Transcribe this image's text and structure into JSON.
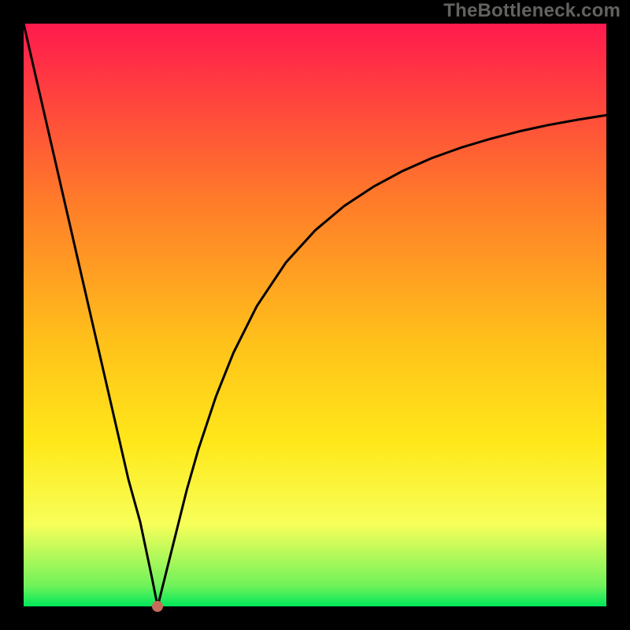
{
  "watermark": "TheBottleneck.com",
  "chart_data": {
    "type": "line",
    "title": "",
    "xlabel": "",
    "ylabel": "",
    "xlim": [
      0,
      100
    ],
    "ylim": [
      0,
      100
    ],
    "background_gradient": [
      "#ff1a4d",
      "#ff7a2a",
      "#ffc21a",
      "#ffe81a",
      "#f7ff5a",
      "#6ff25a",
      "#00e85a"
    ],
    "series": [
      {
        "name": "curve",
        "x": [
          0,
          2,
          4,
          6,
          8,
          10,
          12,
          14,
          16,
          18,
          20,
          22,
          23,
          24,
          26,
          28,
          30,
          33,
          36,
          40,
          45,
          50,
          55,
          60,
          65,
          70,
          75,
          80,
          85,
          90,
          95,
          100
        ],
        "values": [
          100,
          91.3,
          82.6,
          73.9,
          65.2,
          56.5,
          47.8,
          39.1,
          30.4,
          21.7,
          14.5,
          5.0,
          0.0,
          4.0,
          12.0,
          20.0,
          27.0,
          36.0,
          43.5,
          51.5,
          59.0,
          64.5,
          68.7,
          72.0,
          74.7,
          76.9,
          78.7,
          80.2,
          81.5,
          82.6,
          83.5,
          84.3
        ]
      }
    ],
    "marker": {
      "x": 23,
      "y": 0,
      "color": "#c76b5a"
    }
  }
}
